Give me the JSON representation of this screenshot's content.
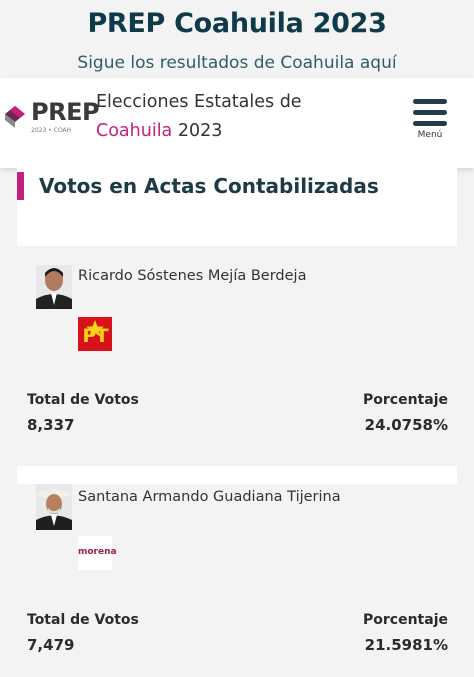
{
  "banner": {
    "title": "PREP Coahuila 2023",
    "subtitle": "Sigue los resultados de Coahuila aquí"
  },
  "header": {
    "logo_text": "PREP",
    "logo_sub": "2023 • COAH",
    "title_line1": "Elecciones Estatales de",
    "title_accent": "Coahuila",
    "title_year": " 2023",
    "menu_label": "Menú",
    "accent_color": "#c2227d"
  },
  "section": {
    "title": "Votos en Actas Contabilizadas"
  },
  "candidates": [
    {
      "name": "Ricardo Sóstenes Mejía Berdeja",
      "party": "PT",
      "party_icon": "pt-logo-icon",
      "votes_label": "Total de Votos",
      "votes": "8,337",
      "pct_label": "Porcentaje",
      "pct": "24.0758%"
    },
    {
      "name": "Santana Armando Guadiana Tijerina",
      "party": "morena",
      "party_icon": "morena-logo-icon",
      "votes_label": "Total de Votos",
      "votes": "7,479",
      "pct_label": "Porcentaje",
      "pct": "21.5981%"
    }
  ]
}
